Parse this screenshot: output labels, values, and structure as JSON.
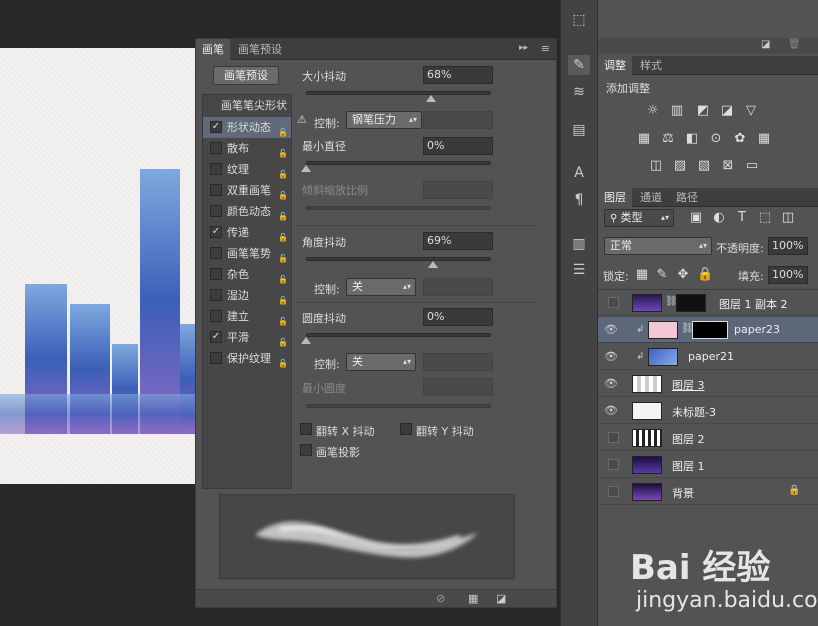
{
  "brush_panel": {
    "tabs": [
      "画笔",
      "画笔预设"
    ],
    "preset_button": "画笔预设",
    "tip_shape_label": "画笔笔尖形状",
    "options": [
      {
        "label": "形状动态",
        "checked": true,
        "selected": true
      },
      {
        "label": "散布",
        "checked": false
      },
      {
        "label": "纹理",
        "checked": false
      },
      {
        "label": "双重画笔",
        "checked": false
      },
      {
        "label": "颜色动态",
        "checked": false
      },
      {
        "label": "传递",
        "checked": true
      },
      {
        "label": "画笔笔势",
        "checked": false
      },
      {
        "label": "杂色",
        "checked": false
      },
      {
        "label": "湿边",
        "checked": false
      },
      {
        "label": "建立",
        "checked": false
      },
      {
        "label": "平滑",
        "checked": true
      },
      {
        "label": "保护纹理",
        "checked": false
      }
    ],
    "size_jitter": {
      "label": "大小抖动",
      "value": "68%",
      "level": 0.68
    },
    "control1": {
      "label": "控制:",
      "value": "钢笔压力"
    },
    "min_diameter": {
      "label": "最小直径",
      "value": "0%",
      "level": 0
    },
    "tilt_scale": {
      "label": "倾斜缩放比例"
    },
    "angle_jitter": {
      "label": "角度抖动",
      "value": "69%",
      "level": 0.69
    },
    "control2": {
      "label": "控制:",
      "value": "关"
    },
    "roundness_jitter": {
      "label": "圆度抖动",
      "value": "0%",
      "level": 0
    },
    "control3": {
      "label": "控制:",
      "value": "关"
    },
    "min_roundness": {
      "label": "最小圆度"
    },
    "flip_x": "翻转 X 抖动",
    "flip_y": "翻转 Y 抖动",
    "brush_projection": "画笔投影"
  },
  "adjustments_panel": {
    "tabs": [
      "调整",
      "样式"
    ],
    "title": "添加调整"
  },
  "layers_panel": {
    "tabs": [
      "图层",
      "通道",
      "路径"
    ],
    "filter_kind": "类型",
    "blend_mode": "正常",
    "opacity_label": "不透明度:",
    "opacity_value": "100%",
    "lock_label": "锁定:",
    "fill_label": "填充:",
    "fill_value": "100%",
    "layers": [
      {
        "name": "图层 1 副本 2",
        "visible": false,
        "linked": true,
        "mask": true
      },
      {
        "name": "paper23",
        "visible": true,
        "selected": true,
        "clipped": true,
        "mask": true
      },
      {
        "name": "paper21",
        "visible": true,
        "clipped": true
      },
      {
        "name": "图层 3",
        "visible": true,
        "underline": true
      },
      {
        "name": "未标题-3",
        "visible": true
      },
      {
        "name": "图层 2",
        "visible": false
      },
      {
        "name": "图层 1",
        "visible": false
      },
      {
        "name": "背景",
        "visible": false,
        "locked": true
      }
    ]
  },
  "watermark": {
    "brand": "Bai 经验",
    "url": "jingyan.baidu.com"
  },
  "colors": {
    "panel": "#535353",
    "dark": "#3e3e3e",
    "selected": "#5c6779"
  }
}
